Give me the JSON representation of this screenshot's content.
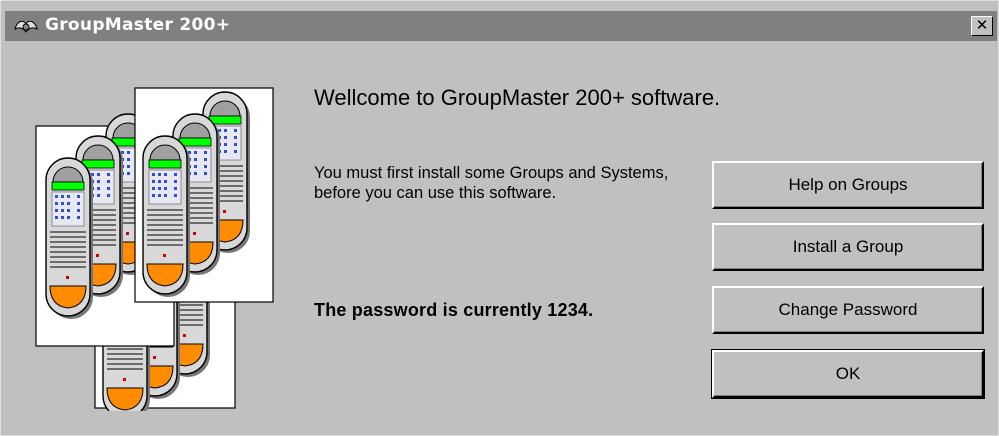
{
  "window": {
    "title": "GroupMaster 200+",
    "close_label": "✕"
  },
  "main": {
    "welcome": "Wellcome to GroupMaster 200+ software.",
    "instructions": "You must first install some Groups and Systems, before you can use this software.",
    "password_notice": "The password is currently 1234."
  },
  "buttons": [
    {
      "label": "Help on Groups"
    },
    {
      "label": "Install a Group"
    },
    {
      "label": "Change Password"
    },
    {
      "label": "OK"
    }
  ],
  "colors": {
    "titlebar": "#808080",
    "dialog_bg": "#c0c0c0",
    "display_green": "#00ff00",
    "speaker_orange": "#ff8c00"
  }
}
